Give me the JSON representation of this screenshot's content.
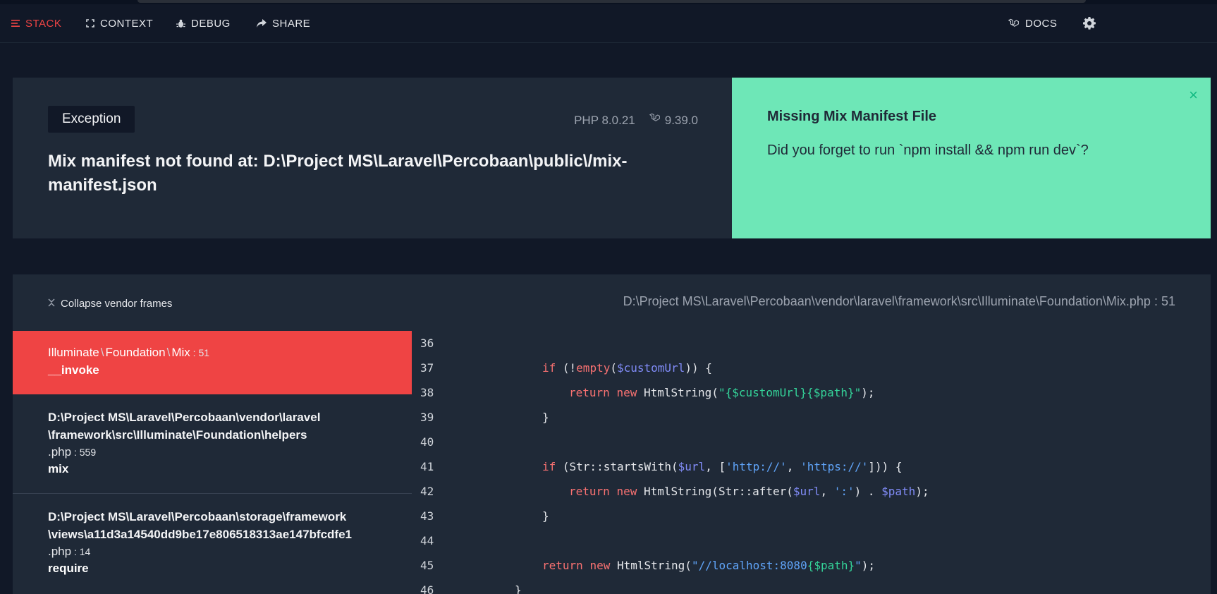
{
  "nav": {
    "stack": "STACK",
    "context": "CONTEXT",
    "debug": "DEBUG",
    "share": "SHARE",
    "docs": "DOCS"
  },
  "exception": {
    "type": "Exception",
    "php_version": "PHP 8.0.21",
    "laravel_version": "9.39.0",
    "message": "Mix manifest not found at: D:\\Project MS\\Laravel\\Percobaan\\public\\/mix-manifest.json"
  },
  "solution": {
    "close": "×",
    "title": "Missing Mix Manifest File",
    "description": "Did you forget to run `npm install && npm run dev`?"
  },
  "frames": {
    "collapse_label": "Collapse vendor frames",
    "items": [
      {
        "class_parts": [
          "Illuminate",
          "Foundation",
          "Mix"
        ],
        "line": "51",
        "method": "__invoke"
      },
      {
        "path1": "D:\\Project MS\\Laravel\\Percobaan\\vendor\\laravel",
        "path2": "\\framework\\src\\Illuminate\\Foundation\\helpers",
        "ext": ".php",
        "line": "559",
        "method": "mix"
      },
      {
        "path1": "D:\\Project MS\\Laravel\\Percobaan\\storage\\framework",
        "path2": "\\views\\a11d3a14540dd9be17e806518313ae147bfcdfe1",
        "ext": ".php",
        "line": "14",
        "method": "require"
      }
    ]
  },
  "code": {
    "file_path": "D:\\Project MS\\Laravel\\Percobaan\\vendor\\laravel\\framework\\src\\Illuminate\\Foundation\\Mix",
    "file_ext": ".php",
    "file_line": "51",
    "line_numbers": [
      "36",
      "37",
      "38",
      "39",
      "40",
      "41",
      "42",
      "43",
      "44",
      "45",
      "46"
    ]
  },
  "colors": {
    "accent_red": "#ef4444",
    "solution_green": "#6ee7b7",
    "panel_bg": "#1f2937",
    "page_bg": "#111827"
  }
}
